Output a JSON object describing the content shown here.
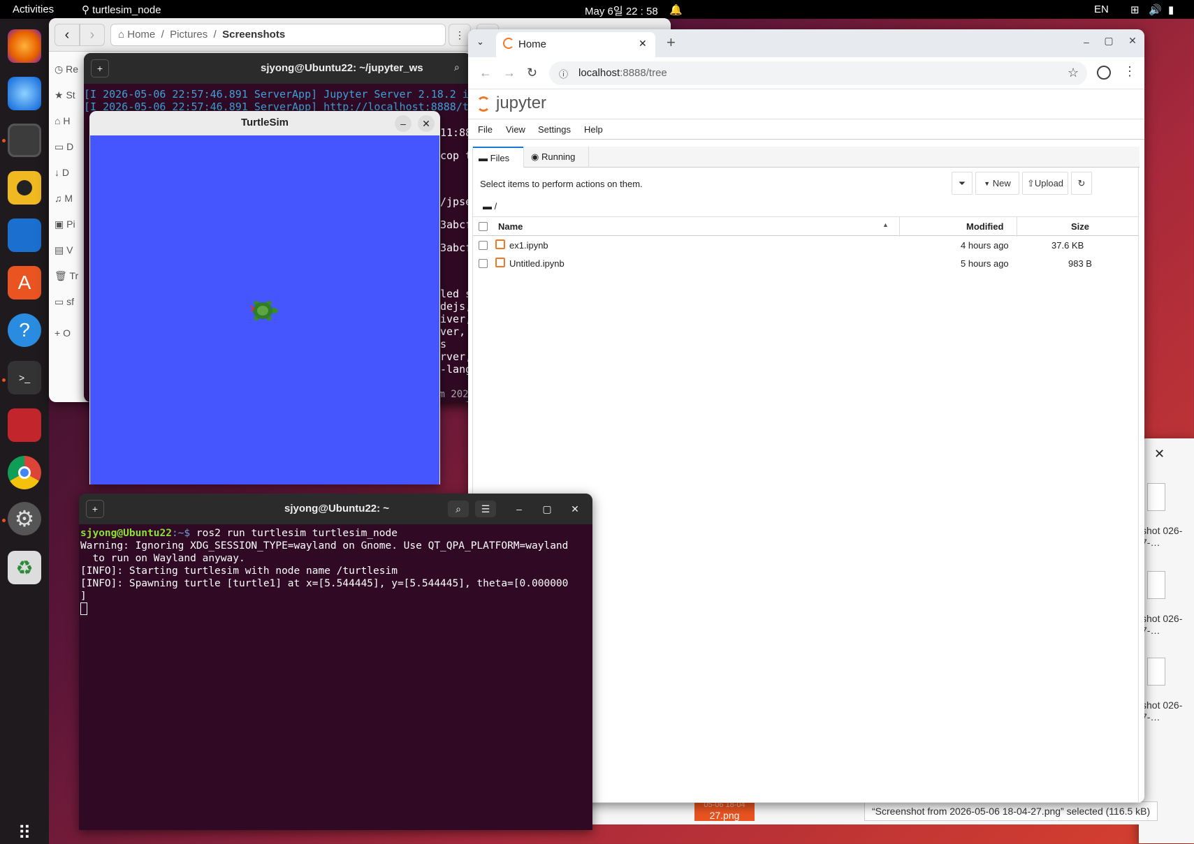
{
  "topbar": {
    "activities": "Activities",
    "app_name": "turtlesim_node",
    "clock": "May 6일  22 : 58",
    "lang": "EN"
  },
  "dock": {
    "apps": [
      "firefox-icon",
      "thunderbird-icon",
      "files-icon",
      "rhythmbox-icon",
      "writer-icon",
      "app-center-icon",
      "help-icon",
      "terminal-icon",
      "monitor-icon",
      "chrome-icon",
      "settings-icon",
      "trash-icon",
      "app-grid-icon"
    ]
  },
  "files": {
    "back": "‹",
    "forward": "›",
    "crumbs": [
      "Home",
      "Pictures",
      "Screenshots"
    ],
    "sidebar": [
      "Re",
      "St",
      "H",
      "D",
      "D",
      "M",
      "Pi",
      "V",
      "Tr",
      "sf",
      "O"
    ],
    "status": "“Screenshot from 2026-05-06 18-04-27.png” selected  (116.5 kB)",
    "thumbs": [
      "shot 026- 7-…",
      "shot 026- 7-…",
      "shot 026- 7-…"
    ],
    "bottom_thumb": "27.png",
    "bottom_partial": "05-06 18-04"
  },
  "jterm": {
    "title": "sjyong@Ubuntu22: ~/jupyter_ws",
    "lines": [
      "[I 2026-05-06 22:57:46.891 ServerApp] Jupyter Server 2.18.2 i",
      "[I 2026-05-06 22:57:46.891 ServerApp] http://localhost:8888/t"
    ],
    "fragments": [
      "11:88",
      "cop t",
      "/jpse",
      "3abcf",
      "3abcf",
      "led s",
      "dejs,",
      "iver,",
      "ver, s",
      "rver,",
      "-lang",
      "om 202"
    ]
  },
  "turtlesim": {
    "title": "TurtleSim",
    "bg": "#4556ff"
  },
  "term": {
    "title": "sjyong@Ubuntu22: ~",
    "prompt_user": "sjyong@Ubuntu22",
    "prompt_rest": ":~$ ",
    "cmd": "ros2 run turtlesim turtlesim_node",
    "lines": [
      "Warning: Ignoring XDG_SESSION_TYPE=wayland on Gnome. Use QT_QPA_PLATFORM=wayland",
      "  to run on Wayland anyway.",
      "[INFO]: Starting turtlesim with node name /turtlesim",
      "[INFO]: Spawning turtle [turtle1] at x=[5.544445], y=[5.544445], theta=[0.000000",
      "]"
    ]
  },
  "chrome": {
    "tab_title": "Home",
    "url_host": "localhost",
    "url_rest": ":8888/tree"
  },
  "jupyter": {
    "logo": "jupyter",
    "menu": [
      "File",
      "View",
      "Settings",
      "Help"
    ],
    "tabs": [
      "Files",
      "Running"
    ],
    "hint": "Select items to perform actions on them.",
    "new_label": "New",
    "upload_label": "Upload",
    "path": "/",
    "columns": {
      "name": "Name",
      "modified": "Modified",
      "size": "Size"
    },
    "files": [
      {
        "name": "ex1.ipynb",
        "modified": "4 hours ago",
        "size": "37.6 KB"
      },
      {
        "name": "Untitled.ipynb",
        "modified": "5 hours ago",
        "size": "983 B"
      }
    ]
  }
}
